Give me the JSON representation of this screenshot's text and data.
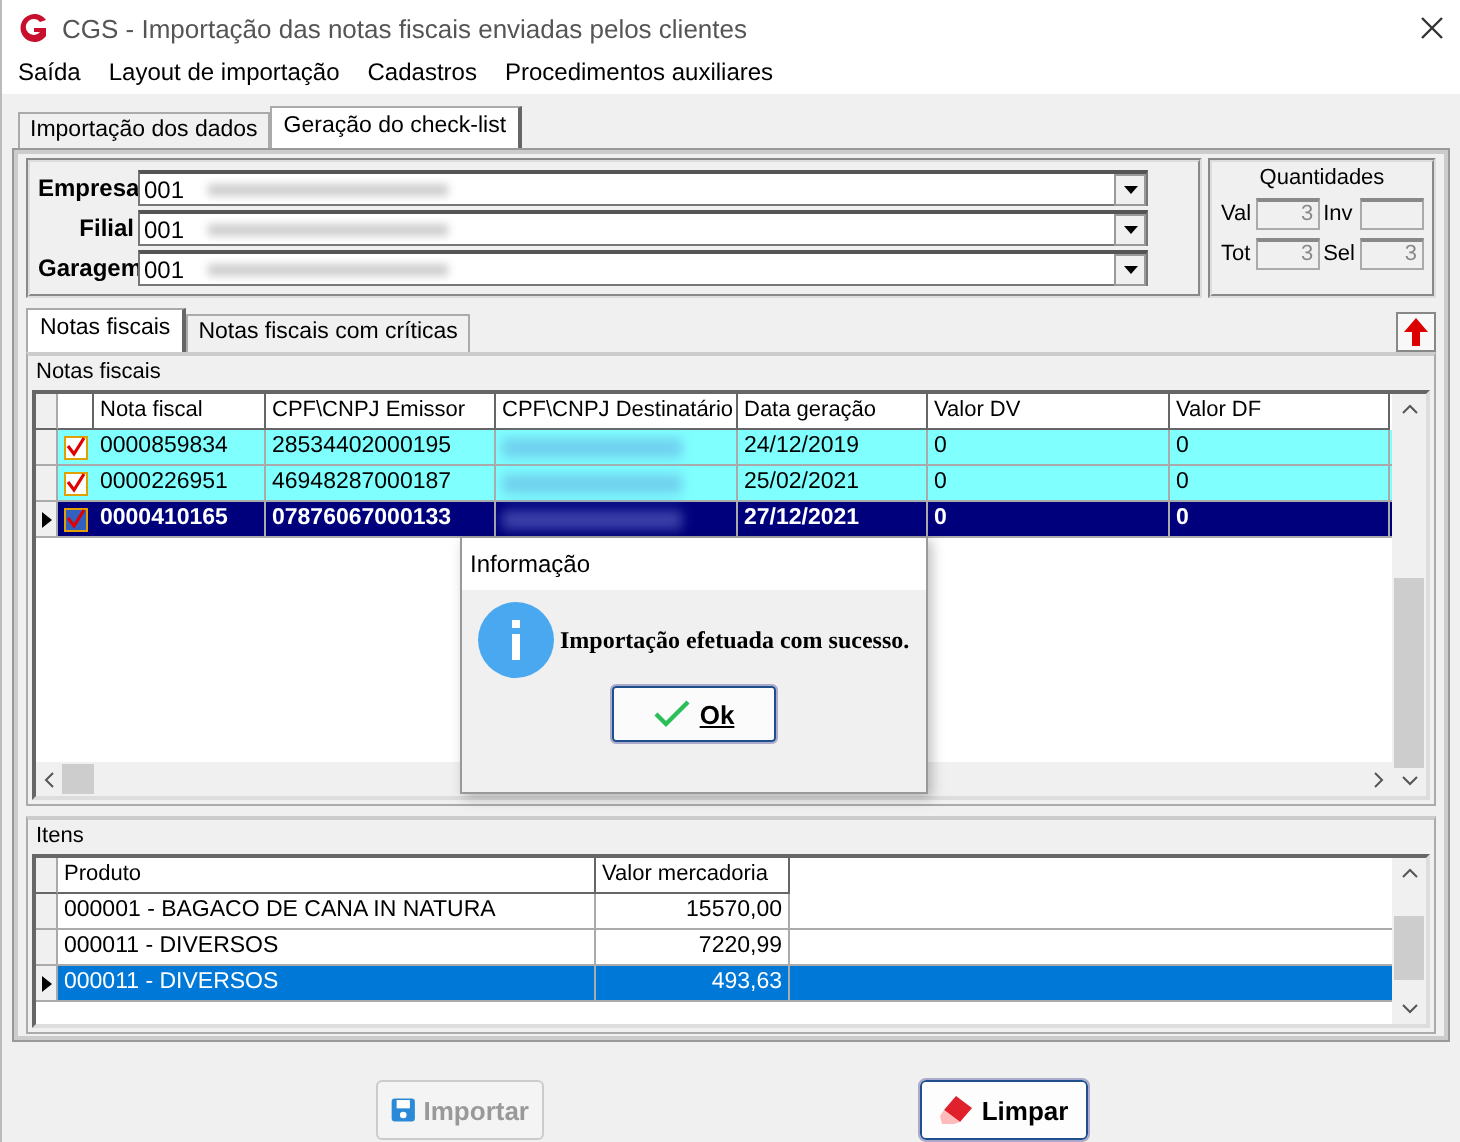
{
  "window": {
    "title": "CGS - Importação das notas fiscais enviadas pelos clientes"
  },
  "menu": [
    "Saída",
    "Layout de importação",
    "Cadastros",
    "Procedimentos auxiliares"
  ],
  "tabs": [
    {
      "label": "Importação dos dados",
      "selected": false
    },
    {
      "label": "Geração do check-list",
      "selected": true
    }
  ],
  "fields": [
    {
      "label": "Empresa",
      "value": "001"
    },
    {
      "label": "Filial",
      "value": "001"
    },
    {
      "label": "Garagem",
      "value": "001"
    }
  ],
  "quantities": {
    "title": "Quantidades",
    "items": [
      {
        "label": "Val",
        "value": "3",
        "disabled": true
      },
      {
        "label": "Inv",
        "value": "",
        "disabled": true
      },
      {
        "label": "Tot",
        "value": "3",
        "disabled": true
      },
      {
        "label": "Sel",
        "value": "3",
        "disabled": true
      }
    ]
  },
  "inner_tabs": [
    {
      "label": "Notas fiscais",
      "selected": true
    },
    {
      "label": "Notas fiscais com críticas",
      "selected": false
    }
  ],
  "notes": {
    "title": "Notas fiscais",
    "columns": [
      "Nota fiscal",
      "CPF\\CNPJ Emissor",
      "CPF\\CNPJ Destinatário",
      "Data geração",
      "Valor DV",
      "Valor DF"
    ],
    "rows": [
      {
        "checked": true,
        "selected": false,
        "cells": [
          "0000859834",
          "28534402000195",
          "",
          "24/12/2019",
          "0",
          "0"
        ]
      },
      {
        "checked": true,
        "selected": false,
        "cells": [
          "0000226951",
          "46948287000187",
          "",
          "25/02/2021",
          "0",
          "0"
        ]
      },
      {
        "checked": true,
        "selected": true,
        "cells": [
          "0000410165",
          "07876067000133",
          "",
          "27/12/2021",
          "0",
          "0"
        ]
      }
    ]
  },
  "items": {
    "title": "Itens",
    "columns": [
      "Produto",
      "Valor mercadoria"
    ],
    "rows": [
      {
        "selected": false,
        "cells": [
          "000001 - BAGACO DE CANA IN NATURA",
          "15570,00"
        ]
      },
      {
        "selected": false,
        "cells": [
          "000011 - DIVERSOS",
          "7220,99"
        ]
      },
      {
        "selected": true,
        "cells": [
          "000011 - DIVERSOS",
          "493,63"
        ]
      }
    ]
  },
  "dialog": {
    "title": "Informação",
    "message": "Importação efetuada com sucesso.",
    "button": "Ok"
  },
  "buttons": [
    {
      "kind": "import",
      "label": "Importar",
      "disabled": true
    },
    {
      "kind": "clear",
      "label": "Limpar",
      "disabled": false
    }
  ]
}
